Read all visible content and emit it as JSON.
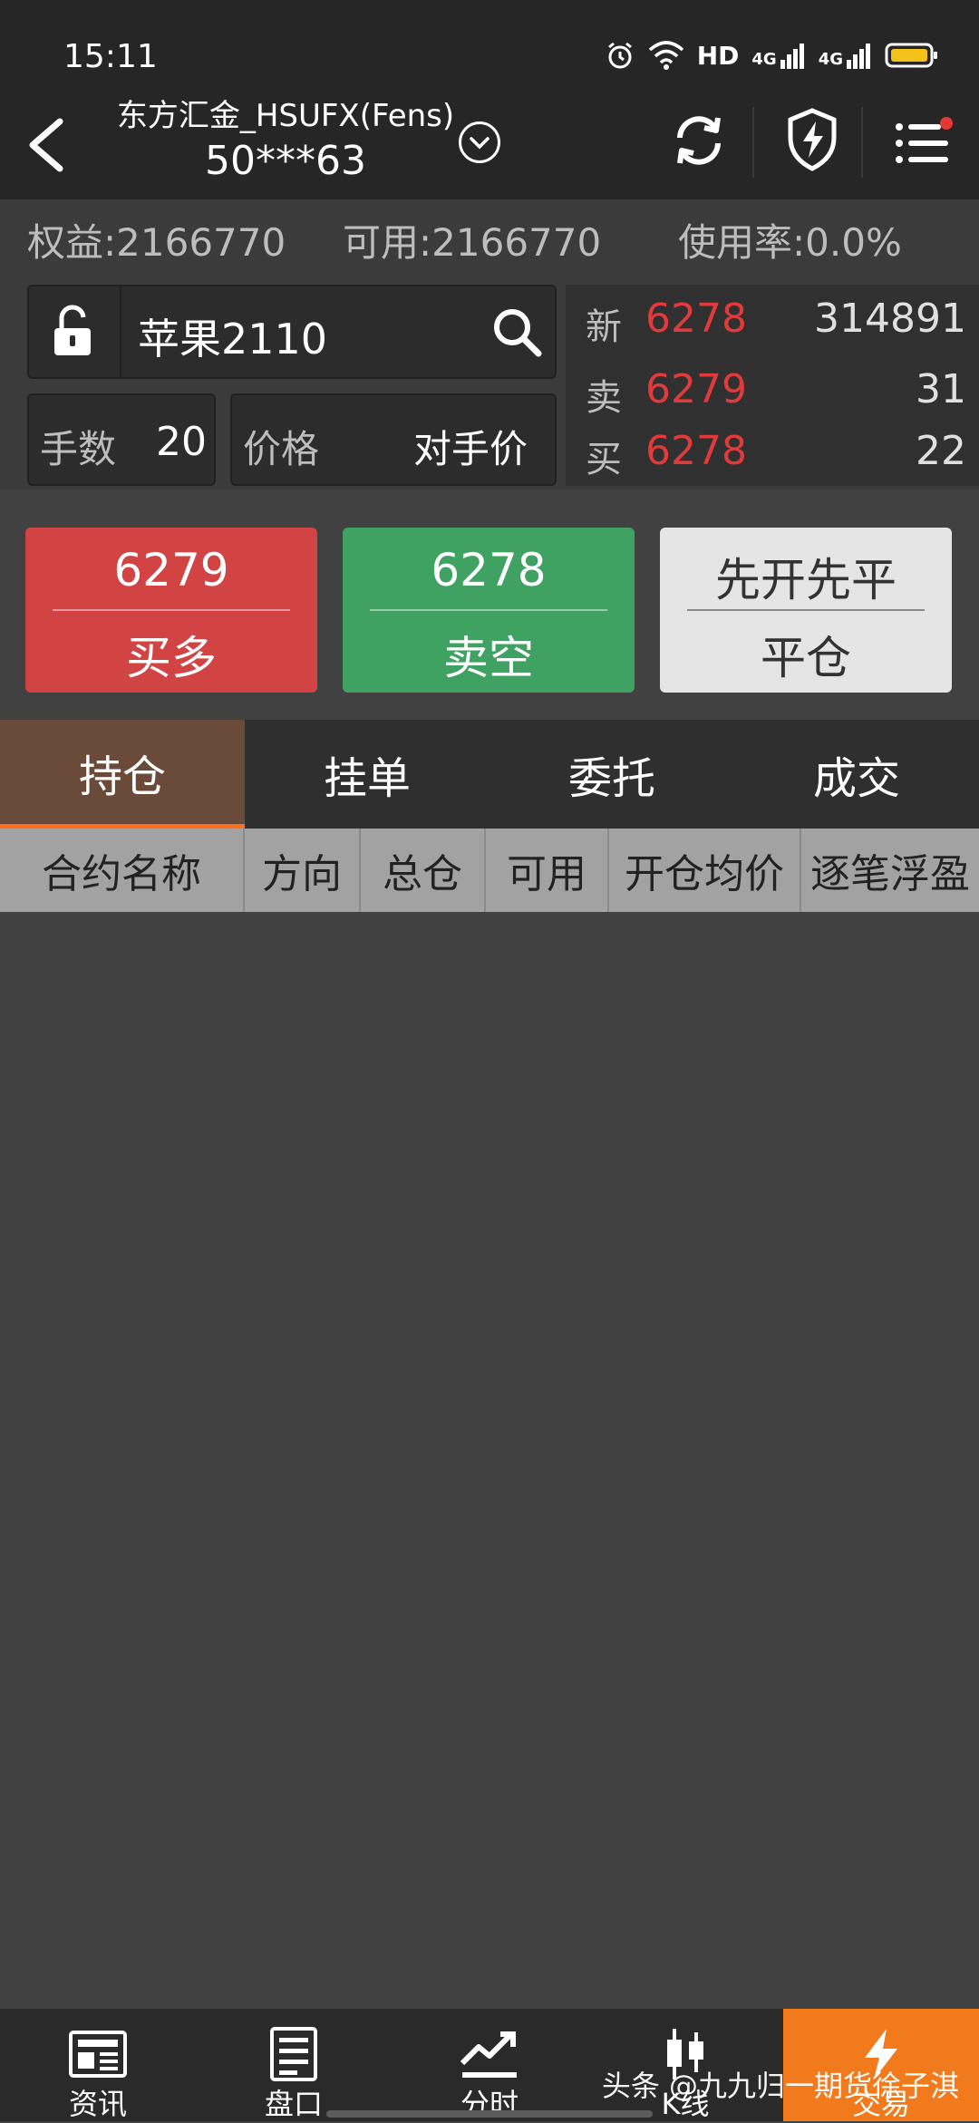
{
  "status": {
    "time": "15:11",
    "network_label": "HD",
    "signal1_label": "4G",
    "signal2_label": "4G"
  },
  "header": {
    "account_title": "东方汇金_HSUFX(Fens)",
    "account_number": "50***63"
  },
  "summary": {
    "equity": "权益:2166770",
    "available": "可用:2166770",
    "usage": "使用率:0.0%"
  },
  "order": {
    "symbol": "苹果2110",
    "qty_label": "手数",
    "qty_value": "20",
    "price_label": "价格",
    "price_value": "对手价"
  },
  "quote": {
    "last_label": "新",
    "last_price": "6278",
    "last_volume": "314891",
    "ask_label": "卖",
    "ask_price": "6279",
    "ask_volume": "31",
    "bid_label": "买",
    "bid_price": "6278",
    "bid_volume": "22"
  },
  "actions": {
    "buy_price": "6279",
    "buy_label": "买多",
    "sell_price": "6278",
    "sell_label": "卖空",
    "close_mode": "先开先平",
    "close_label": "平仓"
  },
  "tabs": [
    "持仓",
    "挂单",
    "委托",
    "成交"
  ],
  "table": {
    "columns": [
      "合约名称",
      "方向",
      "总仓",
      "可用",
      "开仓均价",
      "逐笔浮盈"
    ]
  },
  "nav": [
    "资讯",
    "盘口",
    "分时",
    "K线",
    "交易"
  ],
  "watermark": "头条 @九九归一期货徐子淇",
  "colors": {
    "buy": "#d24343",
    "sell": "#40a262",
    "accent": "#f07a1c",
    "price_red": "#e2393b"
  }
}
